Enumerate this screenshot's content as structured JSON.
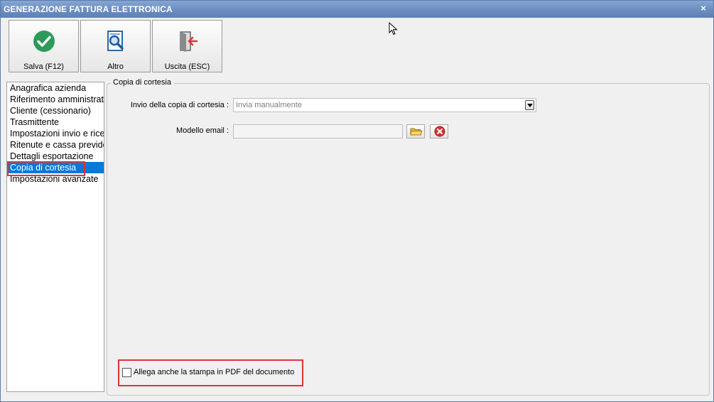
{
  "window": {
    "title": "GENERAZIONE FATTURA ELETTRONICA",
    "close_glyph": "×"
  },
  "toolbar": [
    {
      "label": "Salva (F12)",
      "icon": "checkmark-icon"
    },
    {
      "label": "Altro",
      "icon": "document-search-icon"
    },
    {
      "label": "Uscita (ESC)",
      "icon": "exit-door-icon"
    }
  ],
  "nav": {
    "items": [
      "Anagrafica azienda",
      "Riferimento amministrativo",
      "Cliente (cessionario)",
      "Trasmittente",
      "Impostazioni invio e ricezione",
      "Ritenute e cassa previdenziale",
      "Dettagli esportazione",
      "Copia di cortesia",
      "Impostazioni avanzate"
    ],
    "selected_index": 7
  },
  "panel": {
    "group_title": "Copia di cortesia",
    "invio_label": "Invio della copia di cortesia :",
    "invio_value": "Invia manualmente",
    "modello_label": "Modello email :",
    "modello_value": "",
    "pdf_checkbox_label": "Allega anche la stampa in PDF del documento",
    "pdf_checkbox_checked": false
  },
  "colors": {
    "accent": "#0a78d7",
    "highlight": "#e0343a",
    "title_bar": "#6b8dbf",
    "confirm": "#2e9a5a",
    "cancel": "#d6332c"
  }
}
